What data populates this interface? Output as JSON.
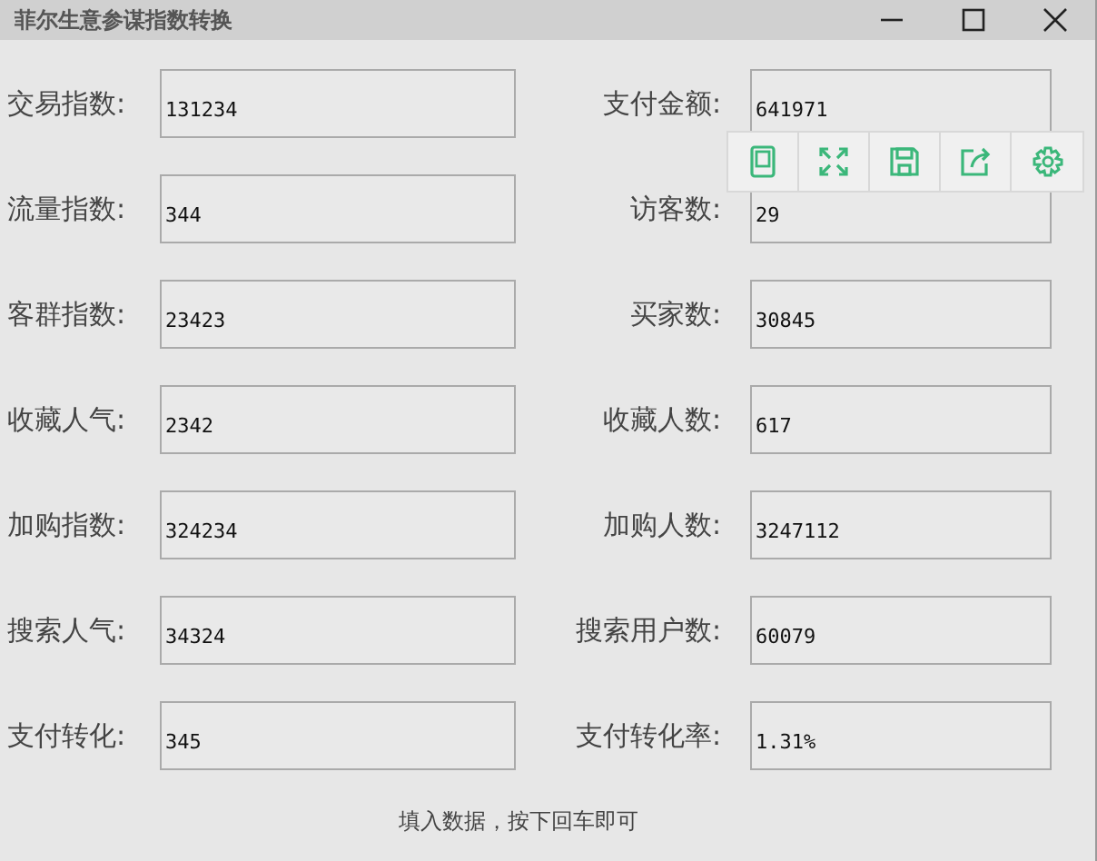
{
  "window": {
    "title": "菲尔生意参谋指数转换"
  },
  "rows": [
    {
      "left": {
        "label": "交易指数:",
        "value": "131234"
      },
      "right": {
        "label": "支付金额:",
        "value": "641971"
      }
    },
    {
      "left": {
        "label": "流量指数:",
        "value": "344"
      },
      "right": {
        "label": "访客数:",
        "value": "29"
      }
    },
    {
      "left": {
        "label": "客群指数:",
        "value": "23423"
      },
      "right": {
        "label": "买家数:",
        "value": "30845"
      }
    },
    {
      "left": {
        "label": "收藏人气:",
        "value": "2342"
      },
      "right": {
        "label": "收藏人数:",
        "value": "617"
      }
    },
    {
      "left": {
        "label": "加购指数:",
        "value": "324234"
      },
      "right": {
        "label": "加购人数:",
        "value": "3247112"
      }
    },
    {
      "left": {
        "label": "搜索人气:",
        "value": "34324"
      },
      "right": {
        "label": "搜索用户数:",
        "value": "60079"
      }
    },
    {
      "left": {
        "label": "支付转化:",
        "value": "345"
      },
      "right": {
        "label": "支付转化率:",
        "value": "1.31%"
      }
    }
  ],
  "toolbar": [
    {
      "kind": "tablet"
    },
    {
      "kind": "expand"
    },
    {
      "kind": "save"
    },
    {
      "kind": "share"
    },
    {
      "kind": "settings"
    }
  ],
  "footer": "填入数据，按下回车即可"
}
